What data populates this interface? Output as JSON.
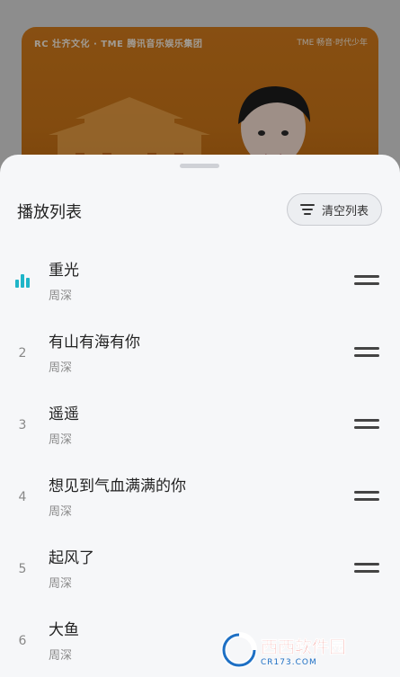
{
  "album": {
    "logo_left": "RC 壮齐文化 · TME 腾讯音乐娱乐集团",
    "logo_right": "TME 畅音·时代少年"
  },
  "playlist": {
    "title": "播放列表",
    "clear_label": "清空列表",
    "now_playing_icon": "equalizer-icon",
    "accent_color": "#1fb5c8",
    "items": [
      {
        "index": "",
        "title": "重光",
        "artist": "周深",
        "playing": true
      },
      {
        "index": "2",
        "title": "有山有海有你",
        "artist": "周深"
      },
      {
        "index": "3",
        "title": "遥遥",
        "artist": "周深"
      },
      {
        "index": "4",
        "title": "想见到气血满满的你",
        "artist": "周深"
      },
      {
        "index": "5",
        "title": "起风了",
        "artist": "周深"
      },
      {
        "index": "6",
        "title": "大鱼",
        "artist": "周深"
      }
    ]
  },
  "watermark": {
    "main": "西西软件园",
    "sub": "CR173.COM"
  }
}
